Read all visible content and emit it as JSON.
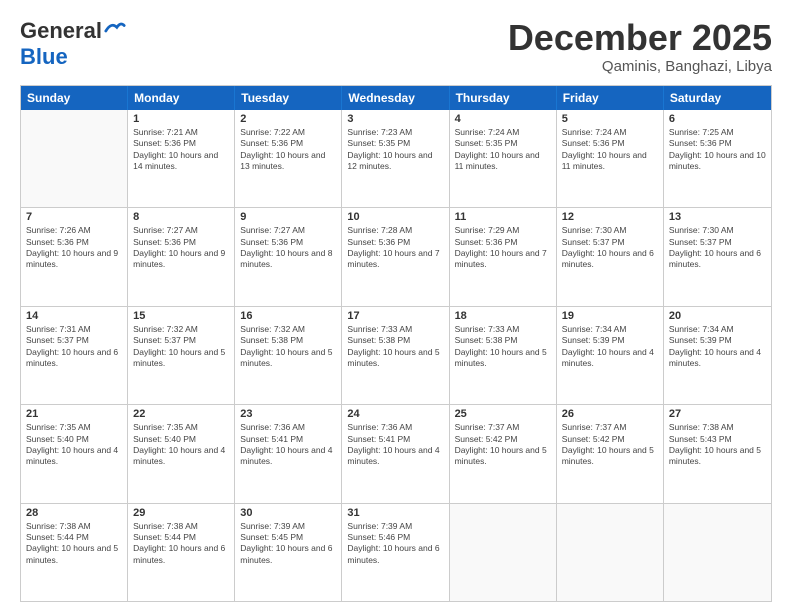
{
  "logo": {
    "general": "General",
    "blue": "Blue"
  },
  "title": "December 2025",
  "subtitle": "Qaminis, Banghazi, Libya",
  "days": [
    "Sunday",
    "Monday",
    "Tuesday",
    "Wednesday",
    "Thursday",
    "Friday",
    "Saturday"
  ],
  "weeks": [
    [
      {
        "num": "",
        "empty": true
      },
      {
        "num": "1",
        "sunrise": "7:21 AM",
        "sunset": "5:36 PM",
        "daylight": "10 hours and 14 minutes."
      },
      {
        "num": "2",
        "sunrise": "7:22 AM",
        "sunset": "5:36 PM",
        "daylight": "10 hours and 13 minutes."
      },
      {
        "num": "3",
        "sunrise": "7:23 AM",
        "sunset": "5:35 PM",
        "daylight": "10 hours and 12 minutes."
      },
      {
        "num": "4",
        "sunrise": "7:24 AM",
        "sunset": "5:35 PM",
        "daylight": "10 hours and 11 minutes."
      },
      {
        "num": "5",
        "sunrise": "7:24 AM",
        "sunset": "5:36 PM",
        "daylight": "10 hours and 11 minutes."
      },
      {
        "num": "6",
        "sunrise": "7:25 AM",
        "sunset": "5:36 PM",
        "daylight": "10 hours and 10 minutes."
      }
    ],
    [
      {
        "num": "7",
        "sunrise": "7:26 AM",
        "sunset": "5:36 PM",
        "daylight": "10 hours and 9 minutes."
      },
      {
        "num": "8",
        "sunrise": "7:27 AM",
        "sunset": "5:36 PM",
        "daylight": "10 hours and 9 minutes."
      },
      {
        "num": "9",
        "sunrise": "7:27 AM",
        "sunset": "5:36 PM",
        "daylight": "10 hours and 8 minutes."
      },
      {
        "num": "10",
        "sunrise": "7:28 AM",
        "sunset": "5:36 PM",
        "daylight": "10 hours and 7 minutes."
      },
      {
        "num": "11",
        "sunrise": "7:29 AM",
        "sunset": "5:36 PM",
        "daylight": "10 hours and 7 minutes."
      },
      {
        "num": "12",
        "sunrise": "7:30 AM",
        "sunset": "5:37 PM",
        "daylight": "10 hours and 6 minutes."
      },
      {
        "num": "13",
        "sunrise": "7:30 AM",
        "sunset": "5:37 PM",
        "daylight": "10 hours and 6 minutes."
      }
    ],
    [
      {
        "num": "14",
        "sunrise": "7:31 AM",
        "sunset": "5:37 PM",
        "daylight": "10 hours and 6 minutes."
      },
      {
        "num": "15",
        "sunrise": "7:32 AM",
        "sunset": "5:37 PM",
        "daylight": "10 hours and 5 minutes."
      },
      {
        "num": "16",
        "sunrise": "7:32 AM",
        "sunset": "5:38 PM",
        "daylight": "10 hours and 5 minutes."
      },
      {
        "num": "17",
        "sunrise": "7:33 AM",
        "sunset": "5:38 PM",
        "daylight": "10 hours and 5 minutes."
      },
      {
        "num": "18",
        "sunrise": "7:33 AM",
        "sunset": "5:38 PM",
        "daylight": "10 hours and 5 minutes."
      },
      {
        "num": "19",
        "sunrise": "7:34 AM",
        "sunset": "5:39 PM",
        "daylight": "10 hours and 4 minutes."
      },
      {
        "num": "20",
        "sunrise": "7:34 AM",
        "sunset": "5:39 PM",
        "daylight": "10 hours and 4 minutes."
      }
    ],
    [
      {
        "num": "21",
        "sunrise": "7:35 AM",
        "sunset": "5:40 PM",
        "daylight": "10 hours and 4 minutes."
      },
      {
        "num": "22",
        "sunrise": "7:35 AM",
        "sunset": "5:40 PM",
        "daylight": "10 hours and 4 minutes."
      },
      {
        "num": "23",
        "sunrise": "7:36 AM",
        "sunset": "5:41 PM",
        "daylight": "10 hours and 4 minutes."
      },
      {
        "num": "24",
        "sunrise": "7:36 AM",
        "sunset": "5:41 PM",
        "daylight": "10 hours and 4 minutes."
      },
      {
        "num": "25",
        "sunrise": "7:37 AM",
        "sunset": "5:42 PM",
        "daylight": "10 hours and 5 minutes."
      },
      {
        "num": "26",
        "sunrise": "7:37 AM",
        "sunset": "5:42 PM",
        "daylight": "10 hours and 5 minutes."
      },
      {
        "num": "27",
        "sunrise": "7:38 AM",
        "sunset": "5:43 PM",
        "daylight": "10 hours and 5 minutes."
      }
    ],
    [
      {
        "num": "28",
        "sunrise": "7:38 AM",
        "sunset": "5:44 PM",
        "daylight": "10 hours and 5 minutes."
      },
      {
        "num": "29",
        "sunrise": "7:38 AM",
        "sunset": "5:44 PM",
        "daylight": "10 hours and 6 minutes."
      },
      {
        "num": "30",
        "sunrise": "7:39 AM",
        "sunset": "5:45 PM",
        "daylight": "10 hours and 6 minutes."
      },
      {
        "num": "31",
        "sunrise": "7:39 AM",
        "sunset": "5:46 PM",
        "daylight": "10 hours and 6 minutes."
      },
      {
        "num": "",
        "empty": true
      },
      {
        "num": "",
        "empty": true
      },
      {
        "num": "",
        "empty": true
      }
    ]
  ]
}
